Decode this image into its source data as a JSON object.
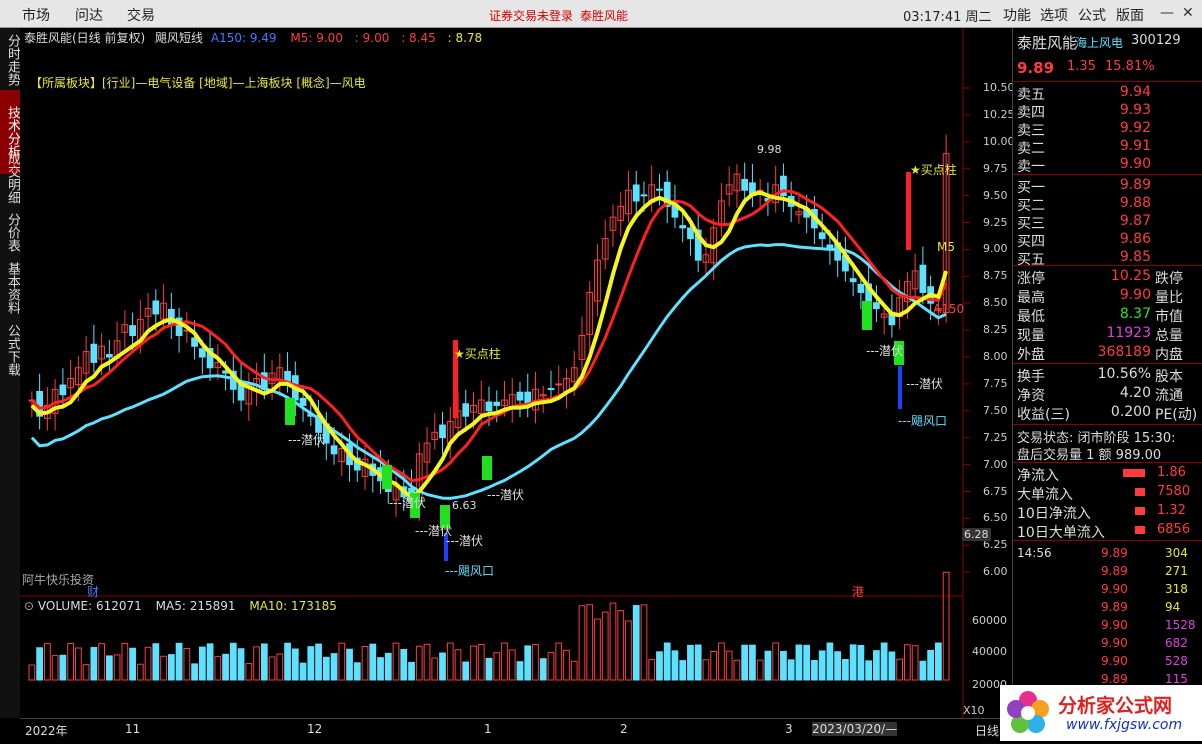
{
  "menu": [
    "市场",
    "问达",
    "交易"
  ],
  "top_message_1": "证券交易未登录",
  "top_message_2": "泰胜风能",
  "clock": "03:17:41 周二",
  "top_right_menu": [
    "功能",
    "选项",
    "公式",
    "版面"
  ],
  "side_tabs": [
    "分时走势",
    "技术分析",
    "成交明细",
    "分价表",
    "基本资料",
    "公式下载"
  ],
  "chart_header": {
    "title": "泰胜风能(日线 前复权)",
    "indicator": "飓风短线",
    "a150": "A150: 9.49",
    "m5": "M5: 9.00",
    "v3": ": 9.00",
    "v4": ": 8.45",
    "v5": ": 8.78"
  },
  "sector_text": "【所属板块】[行业]—电气设备 [地域]—上海板块 [概念]—风电",
  "y_axis": [
    "10.50",
    "10.25",
    "10.00",
    "9.75",
    "9.50",
    "9.25",
    "9.00",
    "8.75",
    "8.50",
    "8.25",
    "8.00",
    "7.75",
    "7.50",
    "7.25",
    "7.00",
    "6.75",
    "6.50",
    "6.25",
    "6.00"
  ],
  "current_price_tag": "6.28",
  "annotations": {
    "hi": "9.98",
    "lo": "6.63",
    "buy1": "★买点柱",
    "buy2": "★买点柱",
    "qf": "---潜伏",
    "jfk": "---飓风口",
    "m5": "M5",
    "a150": "A150",
    "watermark_left": "阿牛快乐投资",
    "cai": "财",
    "gang": "港"
  },
  "volume_header": {
    "vol": "VOLUME: 612071",
    "ma5": "MA5: 215891",
    "ma10": "MA10: 173185"
  },
  "vol_axis": [
    "60000",
    "40000",
    "20000",
    "X10"
  ],
  "x_axis": [
    "2022年",
    "11",
    "12",
    "1",
    "2",
    "3",
    "2023/03/20/—"
  ],
  "right_panel": {
    "name": "泰胜风能",
    "concept": "海上风电",
    "code": "300129",
    "price": "9.89",
    "change": "1.35",
    "pct": "15.81%",
    "asks": [
      [
        "卖五",
        "9.94"
      ],
      [
        "卖四",
        "9.93"
      ],
      [
        "卖三",
        "9.92"
      ],
      [
        "卖二",
        "9.91"
      ],
      [
        "卖一",
        "9.90"
      ]
    ],
    "bids": [
      [
        "买一",
        "9.89"
      ],
      [
        "买二",
        "9.88"
      ],
      [
        "买三",
        "9.87"
      ],
      [
        "买四",
        "9.86"
      ],
      [
        "买五",
        "9.85"
      ]
    ],
    "stats": [
      [
        "涨停",
        "10.25",
        "跌停"
      ],
      [
        "最高",
        "9.90",
        "量比"
      ],
      [
        "最低",
        "8.37",
        "市值"
      ],
      [
        "现量",
        "11923",
        "总量"
      ],
      [
        "外盘",
        "368189",
        "内盘"
      ]
    ],
    "stats2": [
      [
        "换手",
        "10.56%",
        "股本"
      ],
      [
        "净资",
        "4.20",
        "流通"
      ],
      [
        "收益(三)",
        "0.200",
        "PE(动)"
      ]
    ],
    "status": "交易状态: 闭市阶段 15:30:",
    "after": "盘后交易量 1 额 989.00",
    "flows": [
      [
        "净流入",
        "1.86"
      ],
      [
        "大单流入",
        "7580"
      ],
      [
        "10日净流入",
        "1.32"
      ],
      [
        "10日大单流入",
        "6856"
      ]
    ],
    "ticks": [
      [
        "14:56",
        "9.89",
        "304"
      ],
      [
        "",
        "9.89",
        "271"
      ],
      [
        "",
        "9.90",
        "318"
      ],
      [
        "",
        "9.89",
        "94"
      ],
      [
        "",
        "9.90",
        "1528"
      ],
      [
        "",
        "9.90",
        "682"
      ],
      [
        "",
        "9.90",
        "528"
      ],
      [
        "",
        "9.89",
        "115"
      ]
    ]
  },
  "logo_text": "分析家公式网",
  "logo_url": "www.fxjgsw.com",
  "bottom_tab": "日线"
}
